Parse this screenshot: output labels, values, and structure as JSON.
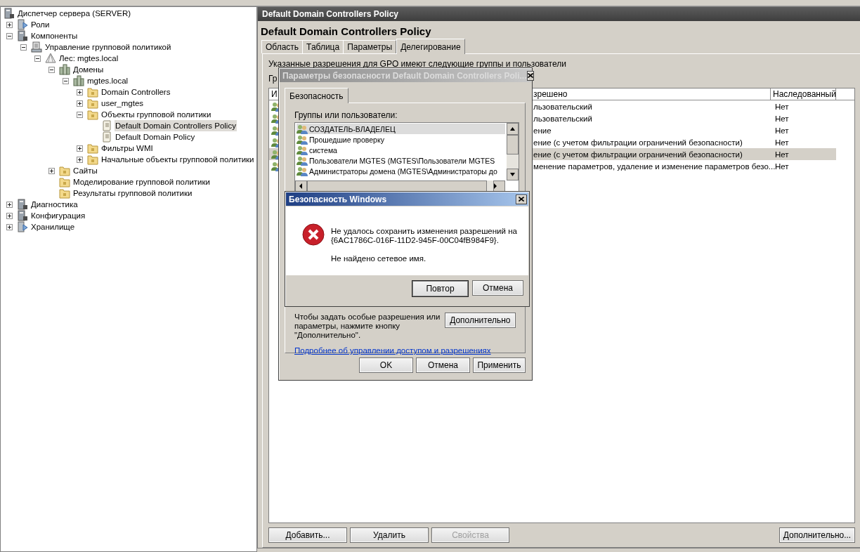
{
  "tree": {
    "root": {
      "label": "Диспетчер сервера (SERVER)",
      "kind": "server"
    },
    "items": [
      {
        "label": "Роли",
        "kind": "roles",
        "expanded": false,
        "selected": false
      },
      {
        "label": "Компоненты",
        "kind": "server",
        "expanded": true,
        "selected": false,
        "children": [
          {
            "label": "Управление групповой политикой",
            "kind": "console",
            "expanded": true,
            "selected": false,
            "children": [
              {
                "label": "Лес: mgtes.local",
                "kind": "forest",
                "expanded": true,
                "selected": false,
                "children": [
                  {
                    "label": "Домены",
                    "kind": "domain",
                    "expanded": true,
                    "selected": false,
                    "children": [
                      {
                        "label": "mgtes.local",
                        "kind": "domain",
                        "expanded": true,
                        "selected": false,
                        "children": [
                          {
                            "label": "Domain Controllers",
                            "kind": "folder",
                            "expanded": false,
                            "selected": false
                          },
                          {
                            "label": "user_mgtes",
                            "kind": "folder",
                            "expanded": false,
                            "selected": false
                          },
                          {
                            "label": "Объекты групповой политики",
                            "kind": "folder",
                            "expanded": true,
                            "selected": false,
                            "children": [
                              {
                                "label": "Default Domain Controllers Policy",
                                "kind": "document",
                                "selected": true
                              },
                              {
                                "label": "Default Domain Policy",
                                "kind": "document",
                                "selected": false
                              }
                            ]
                          },
                          {
                            "label": "Фильтры WMI",
                            "kind": "folder",
                            "expanded": false,
                            "selected": false
                          },
                          {
                            "label": "Начальные объекты групповой политики",
                            "kind": "folder",
                            "expanded": false,
                            "selected": false
                          }
                        ]
                      }
                    ]
                  },
                  {
                    "label": "Сайты",
                    "kind": "folder",
                    "expanded": false,
                    "selected": false
                  },
                  {
                    "label": "Моделирование групповой политики",
                    "kind": "folder",
                    "selected": false
                  },
                  {
                    "label": "Результаты групповой политики",
                    "kind": "folder",
                    "selected": false
                  }
                ]
              }
            ]
          }
        ]
      },
      {
        "label": "Диагностика",
        "kind": "server",
        "expanded": false,
        "selected": false
      },
      {
        "label": "Конфигурация",
        "kind": "server",
        "expanded": false,
        "selected": false
      },
      {
        "label": "Хранилище",
        "kind": "roles",
        "expanded": false,
        "selected": false
      }
    ]
  },
  "details": {
    "title_bar": "Default Domain Controllers Policy",
    "heading": "Default Domain Controllers Policy",
    "tabs": [
      {
        "label": "Область",
        "selected": false
      },
      {
        "label": "Таблица",
        "selected": false
      },
      {
        "label": "Параметры",
        "selected": false
      },
      {
        "label": "Делегирование",
        "selected": true
      }
    ],
    "intro": "Указанные разрешения для GPO имеют следующие группы и пользователи",
    "groups_label": "Гр",
    "table": {
      "columns": [
        "И",
        "зрешено",
        "Наследованный"
      ],
      "rows": [
        {
          "permission": "льзовательский",
          "inherited": "Нет",
          "selected": false
        },
        {
          "permission": "льзовательский",
          "inherited": "Нет",
          "selected": false
        },
        {
          "permission": "ение",
          "inherited": "Нет",
          "selected": false
        },
        {
          "permission": "ение (с учетом фильтрации ограничений безопасности)",
          "inherited": "Нет",
          "selected": false
        },
        {
          "permission": "ение (с учетом фильтрации ограничений безопасности)",
          "inherited": "Нет",
          "selected": true
        },
        {
          "permission": "менение параметров, удаление и изменение параметров безо...",
          "inherited": "Нет",
          "selected": false
        }
      ]
    },
    "buttons": [
      {
        "label": "Добавить...",
        "disabled": false
      },
      {
        "label": "Удалить",
        "disabled": false
      },
      {
        "label": "Свойства",
        "disabled": true
      }
    ],
    "advanced_button": "Дополнительно..."
  },
  "security_dialog": {
    "title": "Параметры безопасности Default Domain Controllers Poli...",
    "tabs": [
      {
        "label": "Безопасность",
        "selected": true
      }
    ],
    "groups_label": "Группы или пользователи:",
    "principals": [
      {
        "name": "СОЗДАТЕЛЬ-ВЛАДЕЛЕЦ",
        "selected": true
      },
      {
        "name": "Прошедшие проверку",
        "selected": false
      },
      {
        "name": "система",
        "selected": false
      },
      {
        "name": "Пользователи MGTES (MGTES\\Пользователи MGTES",
        "selected": false
      },
      {
        "name": "Администраторы домена (MGTES\\Администраторы до",
        "selected": false
      }
    ],
    "advanced_hint": "Чтобы задать особые разрешения или параметры, нажмите кнопку \"Дополнительно\".",
    "advanced_button": "Дополнительно",
    "link": "Подробнее об управлении доступом и разрешениях",
    "buttons": [
      "OK",
      "Отмена",
      "Применить"
    ]
  },
  "error_dialog": {
    "title": "Безопасность Windows",
    "message": "Не удалось сохранить изменения разрешений на {6AC1786C-016F-11D2-945F-00C04fB984F9}.",
    "detail": "Не найдено сетевое имя.",
    "buttons": [
      {
        "label": "Повтор",
        "default": true
      },
      {
        "label": "Отмена",
        "default": false
      }
    ]
  }
}
